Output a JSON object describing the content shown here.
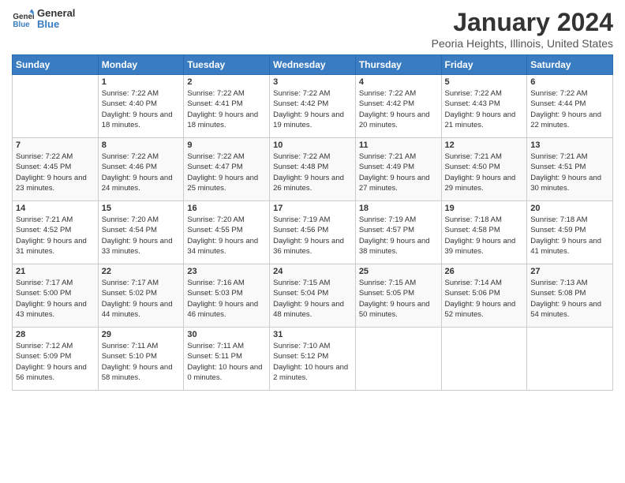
{
  "logo": {
    "text_general": "General",
    "text_blue": "Blue"
  },
  "header": {
    "month": "January 2024",
    "location": "Peoria Heights, Illinois, United States"
  },
  "weekdays": [
    "Sunday",
    "Monday",
    "Tuesday",
    "Wednesday",
    "Thursday",
    "Friday",
    "Saturday"
  ],
  "weeks": [
    [
      {
        "day": "",
        "sunrise": "",
        "sunset": "",
        "daylight": ""
      },
      {
        "day": "1",
        "sunrise": "Sunrise: 7:22 AM",
        "sunset": "Sunset: 4:40 PM",
        "daylight": "Daylight: 9 hours and 18 minutes."
      },
      {
        "day": "2",
        "sunrise": "Sunrise: 7:22 AM",
        "sunset": "Sunset: 4:41 PM",
        "daylight": "Daylight: 9 hours and 18 minutes."
      },
      {
        "day": "3",
        "sunrise": "Sunrise: 7:22 AM",
        "sunset": "Sunset: 4:42 PM",
        "daylight": "Daylight: 9 hours and 19 minutes."
      },
      {
        "day": "4",
        "sunrise": "Sunrise: 7:22 AM",
        "sunset": "Sunset: 4:42 PM",
        "daylight": "Daylight: 9 hours and 20 minutes."
      },
      {
        "day": "5",
        "sunrise": "Sunrise: 7:22 AM",
        "sunset": "Sunset: 4:43 PM",
        "daylight": "Daylight: 9 hours and 21 minutes."
      },
      {
        "day": "6",
        "sunrise": "Sunrise: 7:22 AM",
        "sunset": "Sunset: 4:44 PM",
        "daylight": "Daylight: 9 hours and 22 minutes."
      }
    ],
    [
      {
        "day": "7",
        "sunrise": "Sunrise: 7:22 AM",
        "sunset": "Sunset: 4:45 PM",
        "daylight": "Daylight: 9 hours and 23 minutes."
      },
      {
        "day": "8",
        "sunrise": "Sunrise: 7:22 AM",
        "sunset": "Sunset: 4:46 PM",
        "daylight": "Daylight: 9 hours and 24 minutes."
      },
      {
        "day": "9",
        "sunrise": "Sunrise: 7:22 AM",
        "sunset": "Sunset: 4:47 PM",
        "daylight": "Daylight: 9 hours and 25 minutes."
      },
      {
        "day": "10",
        "sunrise": "Sunrise: 7:22 AM",
        "sunset": "Sunset: 4:48 PM",
        "daylight": "Daylight: 9 hours and 26 minutes."
      },
      {
        "day": "11",
        "sunrise": "Sunrise: 7:21 AM",
        "sunset": "Sunset: 4:49 PM",
        "daylight": "Daylight: 9 hours and 27 minutes."
      },
      {
        "day": "12",
        "sunrise": "Sunrise: 7:21 AM",
        "sunset": "Sunset: 4:50 PM",
        "daylight": "Daylight: 9 hours and 29 minutes."
      },
      {
        "day": "13",
        "sunrise": "Sunrise: 7:21 AM",
        "sunset": "Sunset: 4:51 PM",
        "daylight": "Daylight: 9 hours and 30 minutes."
      }
    ],
    [
      {
        "day": "14",
        "sunrise": "Sunrise: 7:21 AM",
        "sunset": "Sunset: 4:52 PM",
        "daylight": "Daylight: 9 hours and 31 minutes."
      },
      {
        "day": "15",
        "sunrise": "Sunrise: 7:20 AM",
        "sunset": "Sunset: 4:54 PM",
        "daylight": "Daylight: 9 hours and 33 minutes."
      },
      {
        "day": "16",
        "sunrise": "Sunrise: 7:20 AM",
        "sunset": "Sunset: 4:55 PM",
        "daylight": "Daylight: 9 hours and 34 minutes."
      },
      {
        "day": "17",
        "sunrise": "Sunrise: 7:19 AM",
        "sunset": "Sunset: 4:56 PM",
        "daylight": "Daylight: 9 hours and 36 minutes."
      },
      {
        "day": "18",
        "sunrise": "Sunrise: 7:19 AM",
        "sunset": "Sunset: 4:57 PM",
        "daylight": "Daylight: 9 hours and 38 minutes."
      },
      {
        "day": "19",
        "sunrise": "Sunrise: 7:18 AM",
        "sunset": "Sunset: 4:58 PM",
        "daylight": "Daylight: 9 hours and 39 minutes."
      },
      {
        "day": "20",
        "sunrise": "Sunrise: 7:18 AM",
        "sunset": "Sunset: 4:59 PM",
        "daylight": "Daylight: 9 hours and 41 minutes."
      }
    ],
    [
      {
        "day": "21",
        "sunrise": "Sunrise: 7:17 AM",
        "sunset": "Sunset: 5:00 PM",
        "daylight": "Daylight: 9 hours and 43 minutes."
      },
      {
        "day": "22",
        "sunrise": "Sunrise: 7:17 AM",
        "sunset": "Sunset: 5:02 PM",
        "daylight": "Daylight: 9 hours and 44 minutes."
      },
      {
        "day": "23",
        "sunrise": "Sunrise: 7:16 AM",
        "sunset": "Sunset: 5:03 PM",
        "daylight": "Daylight: 9 hours and 46 minutes."
      },
      {
        "day": "24",
        "sunrise": "Sunrise: 7:15 AM",
        "sunset": "Sunset: 5:04 PM",
        "daylight": "Daylight: 9 hours and 48 minutes."
      },
      {
        "day": "25",
        "sunrise": "Sunrise: 7:15 AM",
        "sunset": "Sunset: 5:05 PM",
        "daylight": "Daylight: 9 hours and 50 minutes."
      },
      {
        "day": "26",
        "sunrise": "Sunrise: 7:14 AM",
        "sunset": "Sunset: 5:06 PM",
        "daylight": "Daylight: 9 hours and 52 minutes."
      },
      {
        "day": "27",
        "sunrise": "Sunrise: 7:13 AM",
        "sunset": "Sunset: 5:08 PM",
        "daylight": "Daylight: 9 hours and 54 minutes."
      }
    ],
    [
      {
        "day": "28",
        "sunrise": "Sunrise: 7:12 AM",
        "sunset": "Sunset: 5:09 PM",
        "daylight": "Daylight: 9 hours and 56 minutes."
      },
      {
        "day": "29",
        "sunrise": "Sunrise: 7:11 AM",
        "sunset": "Sunset: 5:10 PM",
        "daylight": "Daylight: 9 hours and 58 minutes."
      },
      {
        "day": "30",
        "sunrise": "Sunrise: 7:11 AM",
        "sunset": "Sunset: 5:11 PM",
        "daylight": "Daylight: 10 hours and 0 minutes."
      },
      {
        "day": "31",
        "sunrise": "Sunrise: 7:10 AM",
        "sunset": "Sunset: 5:12 PM",
        "daylight": "Daylight: 10 hours and 2 minutes."
      },
      {
        "day": "",
        "sunrise": "",
        "sunset": "",
        "daylight": ""
      },
      {
        "day": "",
        "sunrise": "",
        "sunset": "",
        "daylight": ""
      },
      {
        "day": "",
        "sunrise": "",
        "sunset": "",
        "daylight": ""
      }
    ]
  ]
}
